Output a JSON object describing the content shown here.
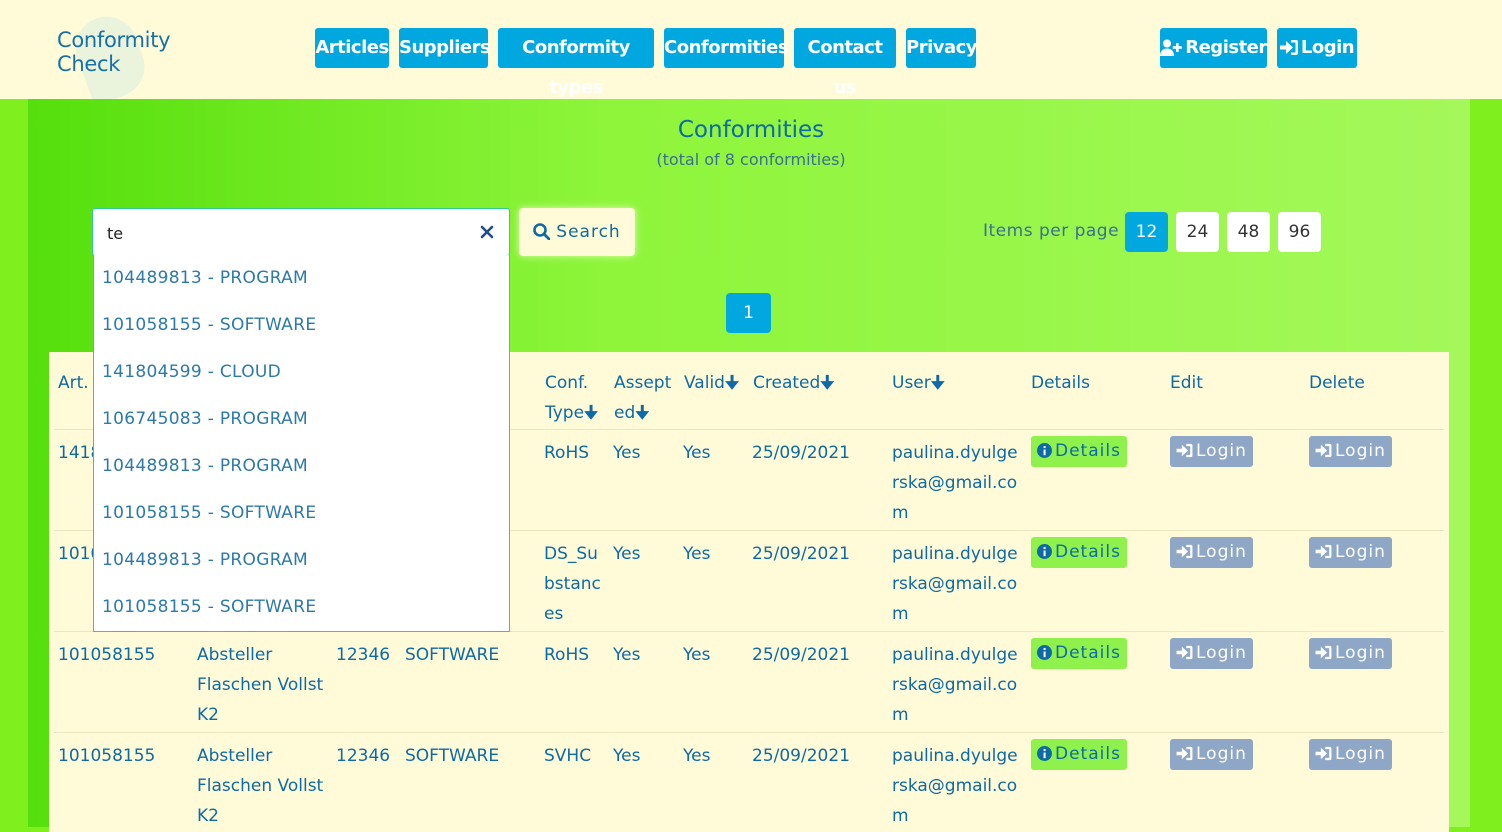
{
  "brand": {
    "line1": "Conformity",
    "line2": "Check"
  },
  "nav": [
    "Articles",
    "Suppliers",
    "Conformity types",
    "Conformities",
    "Contact us",
    "Privacy"
  ],
  "auth": {
    "register": "Register",
    "login": "Login"
  },
  "page": {
    "title": "Conformities",
    "subtitle": "(total of 8 conformities)"
  },
  "search": {
    "value": "te",
    "button_label": "Search"
  },
  "items_per_page": {
    "label": "Items per page",
    "options": [
      "12",
      "24",
      "48",
      "96"
    ],
    "selected": "12"
  },
  "pagination": {
    "current": "1"
  },
  "autocomplete": [
    "104489813 - PROGRAM",
    "101058155 - SOFTWARE",
    "141804599 - CLOUD",
    "106745083 - PROGRAM",
    "104489813 - PROGRAM",
    "101058155 - SOFTWARE",
    "104489813 - PROGRAM",
    "101058155 - SOFTWARE"
  ],
  "table": {
    "headers": {
      "art": "Art.",
      "conf_type": [
        "Conf.",
        "Type"
      ],
      "assepted": [
        "Assept",
        "ed"
      ],
      "valid": "Valid",
      "created": "Created",
      "user": "User",
      "details": "Details",
      "edit": "Edit",
      "delete": "Delete"
    },
    "rows": [
      {
        "art": "1418",
        "name": "",
        "code": "",
        "category": "",
        "conf_type": "RoHS",
        "assepted": "Yes",
        "valid": "Yes",
        "created": "25/09/2021",
        "user": "paulina.dyulgerska@gmail.com"
      },
      {
        "art": "1010",
        "name": "",
        "code": "",
        "category": "",
        "conf_type": "DS_Substances",
        "assepted": "Yes",
        "valid": "Yes",
        "created": "25/09/2021",
        "user": "paulina.dyulgerska@gmail.com"
      },
      {
        "art": "101058155",
        "name": "Absteller Flaschen Vollst K2",
        "code": "12346",
        "category": "SOFTWARE",
        "conf_type": "RoHS",
        "assepted": "Yes",
        "valid": "Yes",
        "created": "25/09/2021",
        "user": "paulina.dyulgerska@gmail.com"
      },
      {
        "art": "101058155",
        "name": "Absteller Flaschen Vollst K2",
        "code": "12346",
        "category": "SOFTWARE",
        "conf_type": "SVHC",
        "assepted": "Yes",
        "valid": "Yes",
        "created": "25/09/2021",
        "user": "paulina.dyulgerska@gmail.com"
      }
    ],
    "details_label": "Details",
    "edit_label": "Login",
    "delete_label": "Login"
  },
  "colors": {
    "accent": "#00a8df",
    "header_bg": "#fffbd8",
    "page_bg": "#7ff01e",
    "details_bg": "#8ff24c",
    "muted_btn": "#8fa7c7"
  }
}
